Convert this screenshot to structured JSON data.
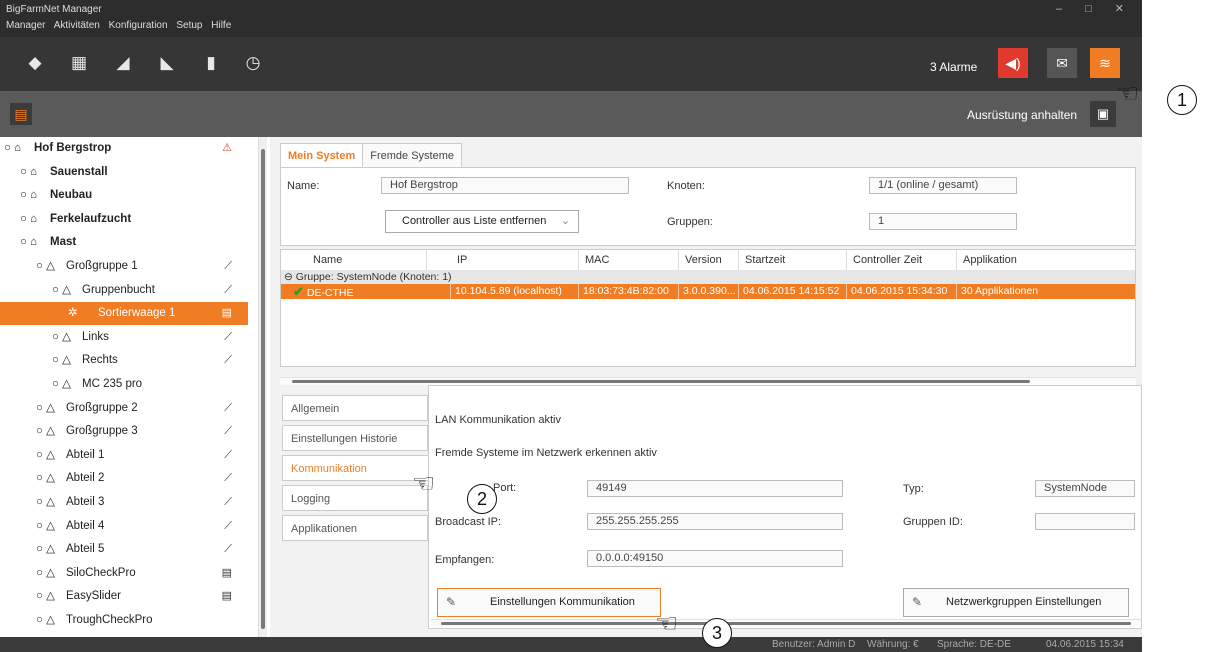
{
  "window": {
    "title": "BigFarmNet Manager",
    "controls": "– □ ✕"
  },
  "menu": [
    "Manager",
    "Aktivitäten",
    "Konfiguration",
    "Setup",
    "Hilfe"
  ],
  "toolbar": {
    "icons": [
      "cube-icon",
      "grid-icon",
      "feed-in-icon",
      "feed-out-icon",
      "silo-icon",
      "timer-icon"
    ],
    "alarm_label": "3 Alarme",
    "alarm_color": "#e03a2f",
    "accent_color": "#f07c23"
  },
  "subbar": {
    "halt_label": "Ausrüstung anhalten"
  },
  "tree": [
    {
      "label": "Hof Bergstrop",
      "bold": true,
      "indent": 0,
      "icon": "⚠"
    },
    {
      "label": "Sauenstall",
      "bold": true,
      "indent": 1,
      "icon": ""
    },
    {
      "label": "Neubau",
      "bold": true,
      "indent": 1,
      "icon": ""
    },
    {
      "label": "Ferkelaufzucht",
      "bold": true,
      "indent": 1,
      "icon": ""
    },
    {
      "label": "Mast",
      "bold": true,
      "indent": 1,
      "icon": ""
    },
    {
      "label": "Großgruppe 1",
      "bold": false,
      "indent": 2,
      "icon": "⟋"
    },
    {
      "label": "Gruppenbucht",
      "bold": false,
      "indent": 3,
      "icon": "⟋"
    },
    {
      "label": "Sortierwaage 1",
      "bold": false,
      "indent": 4,
      "icon": "▤",
      "selected": true
    },
    {
      "label": "Links",
      "bold": false,
      "indent": 3,
      "icon": "⟋"
    },
    {
      "label": "Rechts",
      "bold": false,
      "indent": 3,
      "icon": "⟋"
    },
    {
      "label": "MC 235 pro",
      "bold": false,
      "indent": 3,
      "icon": ""
    },
    {
      "label": "Großgruppe 2",
      "bold": false,
      "indent": 2,
      "icon": "⟋"
    },
    {
      "label": "Großgruppe 3",
      "bold": false,
      "indent": 2,
      "icon": "⟋"
    },
    {
      "label": "Abteil 1",
      "bold": false,
      "indent": 2,
      "icon": "⟋"
    },
    {
      "label": "Abteil 2",
      "bold": false,
      "indent": 2,
      "icon": "⟋"
    },
    {
      "label": "Abteil 3",
      "bold": false,
      "indent": 2,
      "icon": "⟋"
    },
    {
      "label": "Abteil 4",
      "bold": false,
      "indent": 2,
      "icon": "⟋"
    },
    {
      "label": "Abteil 5",
      "bold": false,
      "indent": 2,
      "icon": "⟋"
    },
    {
      "label": "SiloCheckPro",
      "bold": false,
      "indent": 2,
      "icon": "▤"
    },
    {
      "label": "EasySlider",
      "bold": false,
      "indent": 2,
      "icon": "▤"
    },
    {
      "label": "TroughCheckPro",
      "bold": false,
      "indent": 2,
      "icon": ""
    }
  ],
  "tabs": [
    "Mein System",
    "Fremde Systeme"
  ],
  "system": {
    "name_label": "Name:",
    "name_value": "Hof Bergstrop",
    "knoten_label": "Knoten:",
    "knoten_value": "1/1 (online / gesamt)",
    "gruppen_label": "Gruppen:",
    "gruppen_value": "1",
    "dropdown_label": "Controller aus Liste entfernen"
  },
  "grid": {
    "columns": [
      "Name",
      "IP",
      "MAC",
      "Version",
      "Startzeit",
      "Controller Zeit",
      "Applikation"
    ],
    "group_row": "⊖ Gruppe: SystemNode (Knoten: 1)",
    "row": {
      "name": "DE-CTHE",
      "ip": "10.104.5.89 (localhost)",
      "mac": "18:03:73:4B:82:00",
      "version": "3.0.0.390...",
      "start": "04.06.2015 14:15:52",
      "controller_time": "04.06.2015 15:34:30",
      "app": "30 Applikationen"
    }
  },
  "side_tabs": [
    "Allgemein",
    "Einstellungen Historie",
    "Kommunikation",
    "Logging",
    "Applikationen"
  ],
  "detail": {
    "lan_active": "LAN Kommunikation aktiv",
    "fremde_active": "Fremde Systeme im Netzwerk erkennen aktiv",
    "port_label": "Port:",
    "port_value": "49149",
    "typ_label": "Typ:",
    "typ_value": "SystemNode",
    "broadcast_label": "Broadcast IP:",
    "broadcast_value": "255.255.255.255",
    "gruppen_id_label": "Gruppen ID:",
    "gruppen_id_value": "",
    "empfangen_label": "Empfangen:",
    "empfangen_value": "0.0.0.0:49150",
    "btn_kommunikation": "Einstellungen Kommunikation",
    "btn_netzwerk": "Netzwerkgruppen Einstellungen"
  },
  "statusbar": {
    "user": "Benutzer: Admin D",
    "currency": "Währung: €",
    "language": "Sprache: DE-DE",
    "datetime": "04.06.2015 15:34"
  },
  "callouts": [
    "1",
    "2",
    "3"
  ]
}
